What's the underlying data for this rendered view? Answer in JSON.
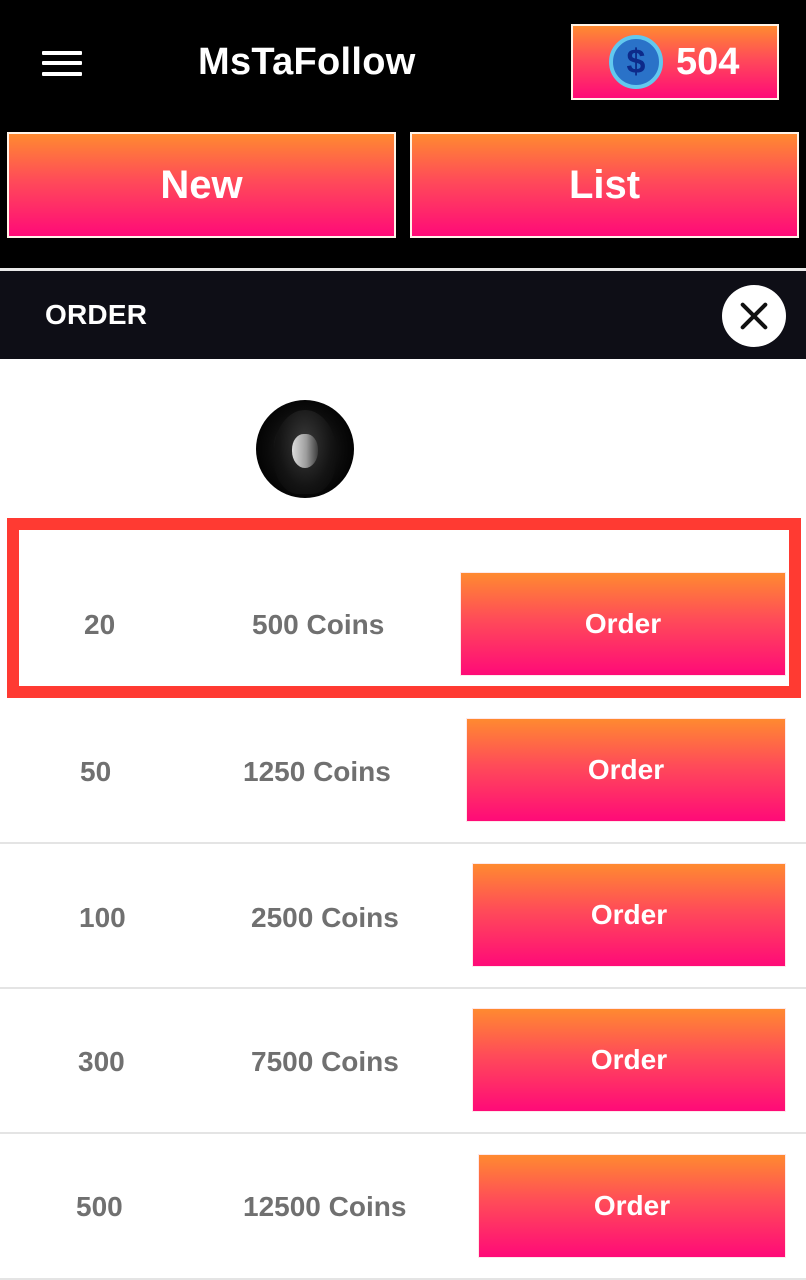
{
  "app": {
    "title": "MsTaFollow",
    "menu_icon": "hamburger-menu-icon",
    "coin_icon": "dollar-coin-icon",
    "coin_symbol": "$",
    "coin_balance": "504"
  },
  "tabs": {
    "new_label": "New",
    "list_label": "List"
  },
  "order_panel": {
    "title": "ORDER",
    "close_icon": "close-x-icon",
    "avatar_icon": "profile-avatar"
  },
  "packages": [
    {
      "quantity": "20",
      "price": "500 Coins",
      "button": "Order",
      "highlighted": true
    },
    {
      "quantity": "50",
      "price": "1250 Coins",
      "button": "Order",
      "highlighted": false
    },
    {
      "quantity": "100",
      "price": "2500 Coins",
      "button": "Order",
      "highlighted": false
    },
    {
      "quantity": "300",
      "price": "7500 Coins",
      "button": "Order",
      "highlighted": false
    },
    {
      "quantity": "500",
      "price": "12500 Coins",
      "button": "Order",
      "highlighted": false
    }
  ],
  "colors": {
    "gradient_top": "#ff8a30",
    "gradient_bottom": "#ff0a78",
    "highlight_border": "#ff3a32",
    "header_bg": "#0e0e16",
    "text_gray": "#707070"
  }
}
